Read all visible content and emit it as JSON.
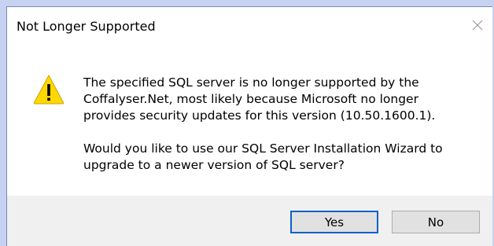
{
  "window": {
    "title": "Not Longer Supported",
    "close_icon": "close-icon"
  },
  "message": {
    "icon": "warning-icon",
    "paragraph1_lines": [
      "The specified SQL server is no longer supported by the",
      "Coffalyser.Net, most likely because Microsoft no longer",
      "provides security updates for this version (10.50.1600.1)."
    ],
    "paragraph2_lines": [
      "Would you like to use our SQL Server Installation Wizard to",
      "upgrade to a newer version of SQL server?"
    ]
  },
  "buttons": {
    "yes_label": "Yes",
    "no_label": "No"
  },
  "colors": {
    "accent": "#0a61c9",
    "warning_fill": "#ffd800",
    "footer_bg": "#f0f0f0"
  }
}
